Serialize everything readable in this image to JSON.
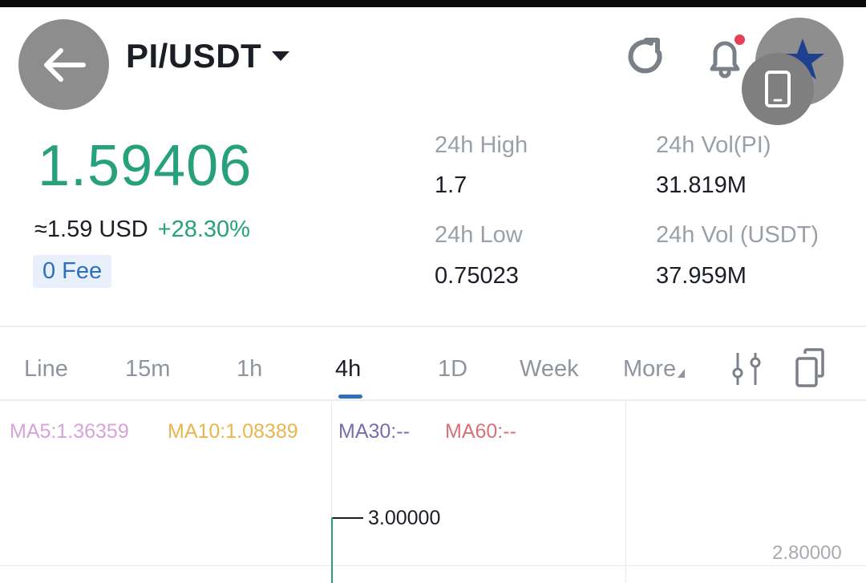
{
  "header": {
    "pair": "PI/USDT",
    "icons": [
      "back-arrow-icon",
      "caret-down-icon",
      "refresh-icon",
      "bell-icon",
      "star-icon",
      "phone-icon"
    ]
  },
  "ticker": {
    "price": "1.59406",
    "usd": "≈1.59 USD",
    "change": "+28.30%",
    "fee_badge": "0 Fee",
    "high_label": "24h High",
    "high_value": "1.7",
    "low_label": "24h Low",
    "low_value": "0.75023",
    "vol_pi_label": "24h Vol(PI)",
    "vol_pi_value": "31.819M",
    "vol_usdt_label": "24h Vol (USDT)",
    "vol_usdt_value": "37.959M"
  },
  "tabs": {
    "line": "Line",
    "m15": "15m",
    "h1": "1h",
    "h4": "4h",
    "d1": "1D",
    "week": "Week",
    "more": "More",
    "active": "4h"
  },
  "chart": {
    "ma5": "MA5:1.36359",
    "ma10": "MA10:1.08389",
    "ma30": "MA30:--",
    "ma60": "MA60:--",
    "max_marker": "3.00000",
    "axis_label": "2.80000"
  },
  "colors": {
    "up": "#26a17b",
    "accent": "#2f6fbd",
    "ma5": "#d6a4d8",
    "ma10": "#e8b64c",
    "ma30": "#7b6bb0",
    "ma60": "#d9717a"
  }
}
